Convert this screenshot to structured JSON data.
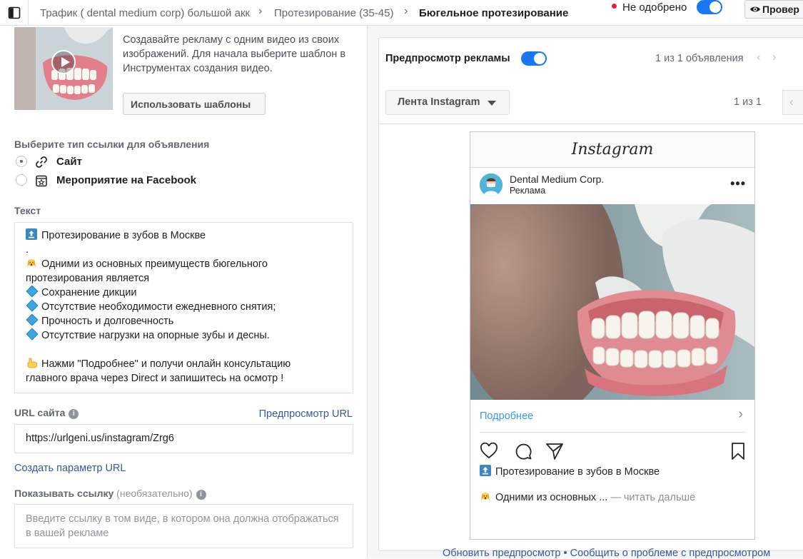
{
  "topbar": {
    "breadcrumb_1": "Трафик ( dental medium corp) большой акк",
    "breadcrumb_2": "Протезирование (35-45)",
    "breadcrumb_3": "Бюгельное протезирование",
    "status": "Не одобрено",
    "status_color": "#e41e3f",
    "review_label": "Провер"
  },
  "template": {
    "description": "Создавайте рекламу с одним видео из своих изображений. Для начала выберите шаблон в Инструментах создания видео.",
    "use_templates_label": "Использовать шаблоны"
  },
  "link_type": {
    "label": "Выберите тип ссылки для объявления",
    "options": [
      {
        "label": "Сайт",
        "icon": "link-icon",
        "selected": true
      },
      {
        "label": "Мероприятие на Facebook",
        "icon": "calendar-star-icon",
        "selected": false
      }
    ]
  },
  "text": {
    "label": "Текст",
    "lines": [
      "Протезирование в зубов в Москве",
      ".",
      "Одними из основных преимуществ бюгельного",
      "протезирования является",
      "Сохранение дикции",
      "Отсутствие необходимости ежедневного снятия;",
      "Прочность и долговечность",
      "Отсутствие нагрузки на опорные зубы и десны.",
      "",
      "Нажми \"Подробнее\" и получи онлайн консультацию",
      "главного врача через Direct и запишитесь на осмотр !"
    ]
  },
  "url": {
    "label": "URL сайта",
    "preview_link": "Предпросмотр URL",
    "value": "https://urlgeni.us/instagram/Zrg6",
    "create_param": "Создать параметр URL"
  },
  "display_link": {
    "label": "Показывать ссылку",
    "optional": "(необязательно)",
    "placeholder": "Введите ссылку в том виде, в котором она должна отображаться в вашей рекламе"
  },
  "preview": {
    "title": "Предпросмотр рекламы",
    "ads_counter": "1 из 1 объявления",
    "placement": "Лента Instagram",
    "placement_counter": "1 из 1"
  },
  "instagram": {
    "brand": "Instagram",
    "account": "Dental Medium Corp.",
    "sponsored": "Реклама",
    "cta": "Подробнее",
    "caption_1": "Протезирование в зубов в Москве",
    "caption_2": "Одними из основных ...",
    "read_more": " — читать дальше"
  },
  "footer": {
    "refresh": "Обновить предпросмотр",
    "separator": " • ",
    "report": "Сообщить о проблеме с предпросмотром"
  },
  "colors": {
    "accent": "#1877f2",
    "link": "#385898",
    "ig_link": "#3897f0"
  }
}
